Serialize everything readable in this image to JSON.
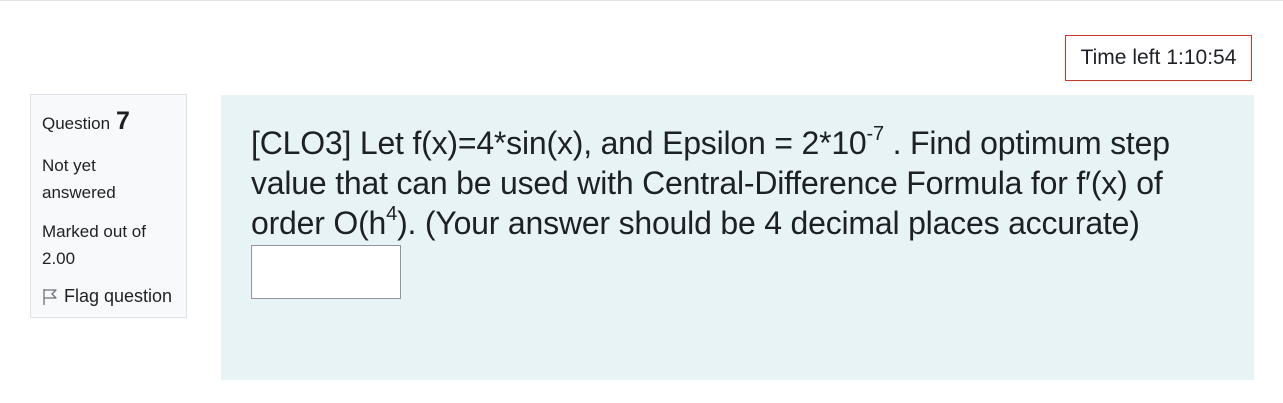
{
  "timer": {
    "label": "Time left",
    "value": "1:10:54"
  },
  "question_info": {
    "question_word": "Question",
    "number": "7",
    "state_line1": "Not yet",
    "state_line2": "answered",
    "grade_line1": "Marked out of",
    "grade_line2": "2.00",
    "flag_label": "Flag question",
    "flag_icon": "flag-outline-icon"
  },
  "question": {
    "part1": "[CLO3] Let f(x)=4*sin(x), and Epsilon = 2*10",
    "exp1": "-7",
    "part2": " . Find optimum step value that can be used with Central-Difference Formula for f′(x) of order O(h",
    "exp2": "4",
    "part3": "). (Your answer should be 4 decimal places accurate)",
    "answer_value": ""
  },
  "colors": {
    "content_bg": "#e7f3f5",
    "timer_border": "#c0392b",
    "info_bg": "#f8f9fa"
  }
}
